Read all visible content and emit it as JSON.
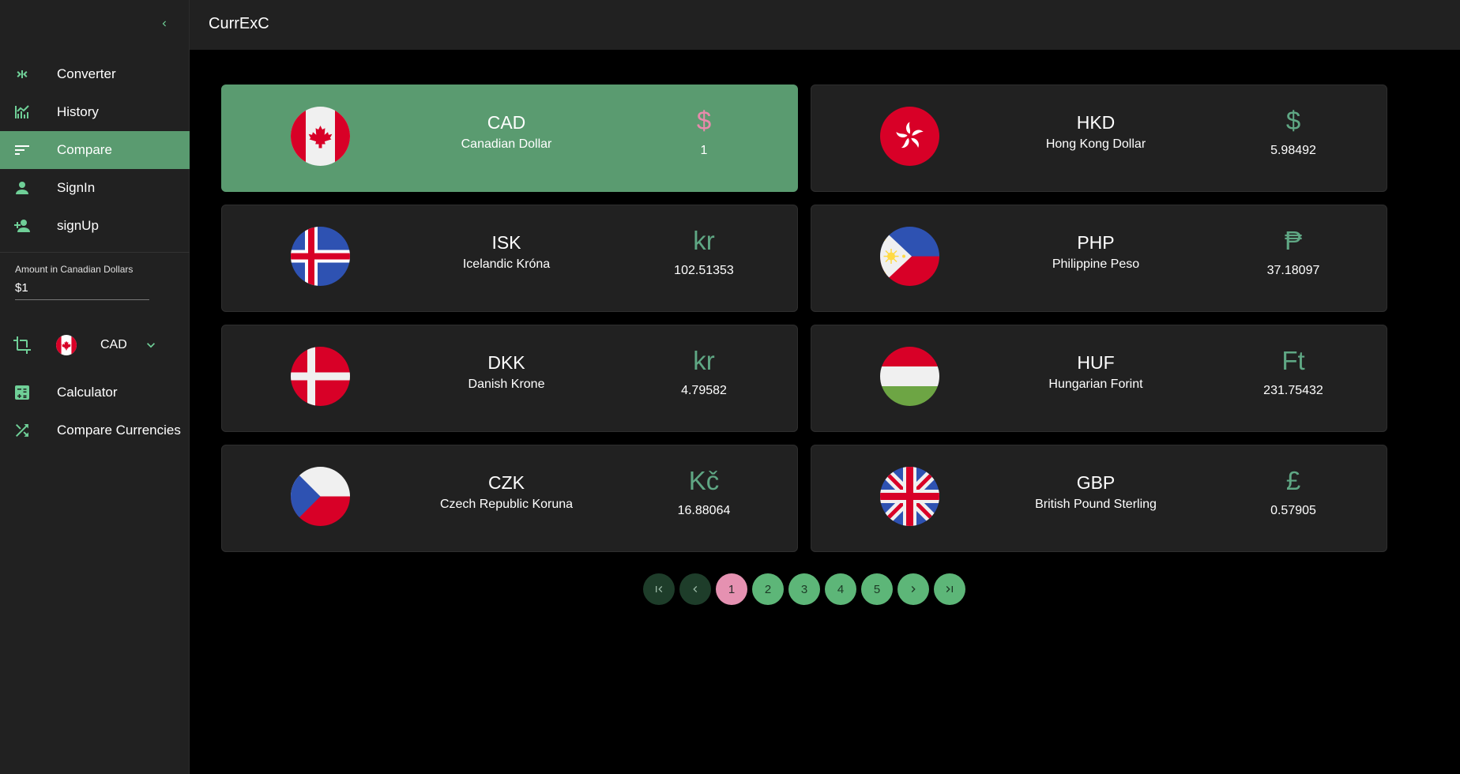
{
  "app": {
    "title": "CurrExC"
  },
  "sidebar": {
    "nav": [
      {
        "label": "Converter",
        "icon": "converter-icon",
        "active": false
      },
      {
        "label": "History",
        "icon": "history-chart-icon",
        "active": false
      },
      {
        "label": "Compare",
        "icon": "compare-sort-icon",
        "active": true
      },
      {
        "label": "SignIn",
        "icon": "person-icon",
        "active": false
      },
      {
        "label": "signUp",
        "icon": "person-add-icon",
        "active": false
      }
    ],
    "amount": {
      "label": "Amount in Canadian Dollars",
      "value": "$1"
    },
    "base_currency": {
      "code": "CAD",
      "flag": "canada"
    },
    "tools": [
      {
        "label": "Calculator",
        "icon": "calculator-icon"
      },
      {
        "label": "Compare Currencies",
        "icon": "shuffle-icon"
      }
    ]
  },
  "cards": [
    {
      "code": "CAD",
      "name": "Canadian Dollar",
      "symbol": "$",
      "rate": "1",
      "flag": "canada",
      "selected": true
    },
    {
      "code": "HKD",
      "name": "Hong Kong Dollar",
      "symbol": "$",
      "rate": "5.98492",
      "flag": "hongkong",
      "selected": false
    },
    {
      "code": "ISK",
      "name": "Icelandic Króna",
      "symbol": "kr",
      "rate": "102.51353",
      "flag": "iceland",
      "selected": false
    },
    {
      "code": "PHP",
      "name": "Philippine Peso",
      "symbol": "₱",
      "rate": "37.18097",
      "flag": "philippines",
      "selected": false
    },
    {
      "code": "DKK",
      "name": "Danish Krone",
      "symbol": "kr",
      "rate": "4.79582",
      "flag": "denmark",
      "selected": false
    },
    {
      "code": "HUF",
      "name": "Hungarian Forint",
      "symbol": "Ft",
      "rate": "231.75432",
      "flag": "hungary",
      "selected": false
    },
    {
      "code": "CZK",
      "name": "Czech Republic Koruna",
      "symbol": "Kč",
      "rate": "16.88064",
      "flag": "czech",
      "selected": false
    },
    {
      "code": "GBP",
      "name": "British Pound Sterling",
      "symbol": "£",
      "rate": "0.57905",
      "flag": "uk",
      "selected": false
    }
  ],
  "pagination": {
    "pages": [
      "1",
      "2",
      "3",
      "4",
      "5"
    ],
    "current": "1"
  },
  "colors": {
    "accent": "#5a9b70",
    "symbol": "#5fa784",
    "highlight_symbol": "#e88aac",
    "page_current": "#e591b1",
    "page_button": "#5db678"
  }
}
